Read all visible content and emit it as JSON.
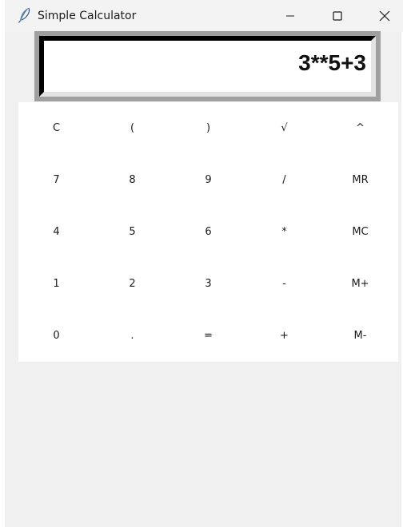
{
  "window": {
    "title": "Simple Calculator",
    "controls": {
      "minimize_icon": "minimize-icon",
      "maximize_icon": "maximize-icon",
      "close_icon": "close-icon"
    }
  },
  "display": {
    "value": "3**5+3"
  },
  "keypad": {
    "rows": [
      [
        "C",
        "(",
        ")",
        "√",
        "^"
      ],
      [
        "7",
        "8",
        "9",
        "/",
        "MR"
      ],
      [
        "4",
        "5",
        "6",
        "*",
        "MC"
      ],
      [
        "1",
        "2",
        "3",
        "-",
        "M+"
      ],
      [
        "0",
        ".",
        "=",
        "+",
        "M-"
      ]
    ]
  },
  "colors": {
    "window_bg": "#f0f0f0",
    "keypad_bg": "#ffffff",
    "display_shadow": "#000000",
    "display_frame": "#a0a0a0"
  }
}
